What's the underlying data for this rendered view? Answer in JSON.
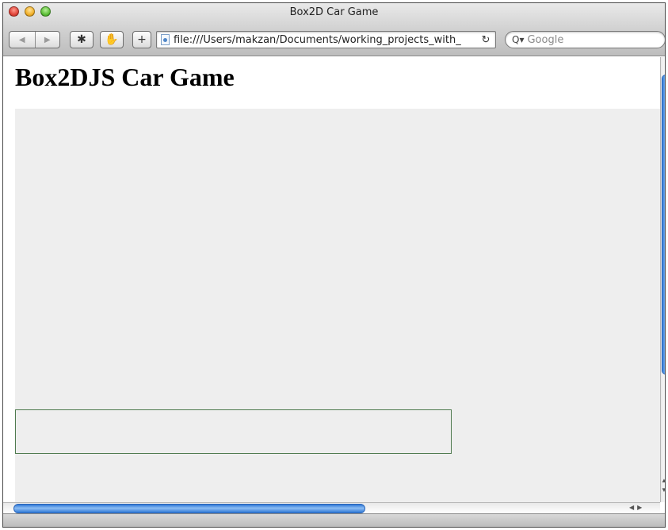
{
  "window": {
    "title": "Box2D Car Game"
  },
  "toolbar": {
    "back_glyph": "◀",
    "forward_glyph": "▶",
    "snapback_glyph": "✱",
    "clip_glyph": "✋",
    "add_glyph": "+",
    "address": "file:///Users/makzan/Documents/working_projects_with_",
    "reload_glyph": "↻",
    "search_placeholder": "Google",
    "search_glyph": "Q▾"
  },
  "page": {
    "heading": "Box2DJS Car Game"
  },
  "icons": {
    "back": "back-arrow-icon",
    "forward": "forward-arrow-icon",
    "snapback": "snapback-icon",
    "clip": "evernote-clip-icon",
    "add": "add-bookmark-icon",
    "page": "page-icon",
    "reload": "reload-icon",
    "search": "search-icon"
  },
  "colors": {
    "canvas_background": "#eeeeee",
    "ground_outline": "#4f7a4f",
    "scroll_thumb": "#2f79d8"
  },
  "scroll": {
    "up_glyph": "▲",
    "down_glyph": "▼",
    "left_glyph": "◀",
    "right_glyph": "▶"
  }
}
